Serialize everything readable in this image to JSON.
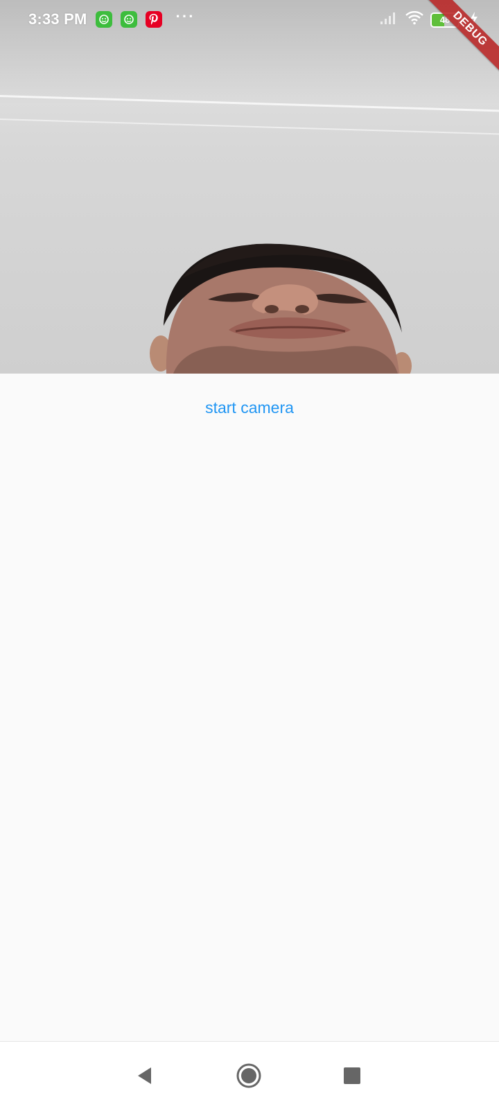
{
  "status_bar": {
    "time": "3:33 PM",
    "more_indicator": "···",
    "notification_icons": [
      "app-green-icon",
      "app-green-icon",
      "pinterest-icon"
    ],
    "battery_level": "48",
    "battery_fraction": 0.48,
    "icons": [
      "signal-icon",
      "wifi-icon",
      "battery-icon",
      "charging-icon"
    ]
  },
  "debug_banner": {
    "label": "DEBUG"
  },
  "main": {
    "start_camera_label": "start camera"
  },
  "navigation": {
    "buttons": [
      "back-icon",
      "home-icon",
      "recents-icon"
    ]
  },
  "colors": {
    "accent": "#2196f3",
    "background": "#fafafa",
    "debug_banner": "#b82020",
    "nav_icons": "#666666"
  }
}
